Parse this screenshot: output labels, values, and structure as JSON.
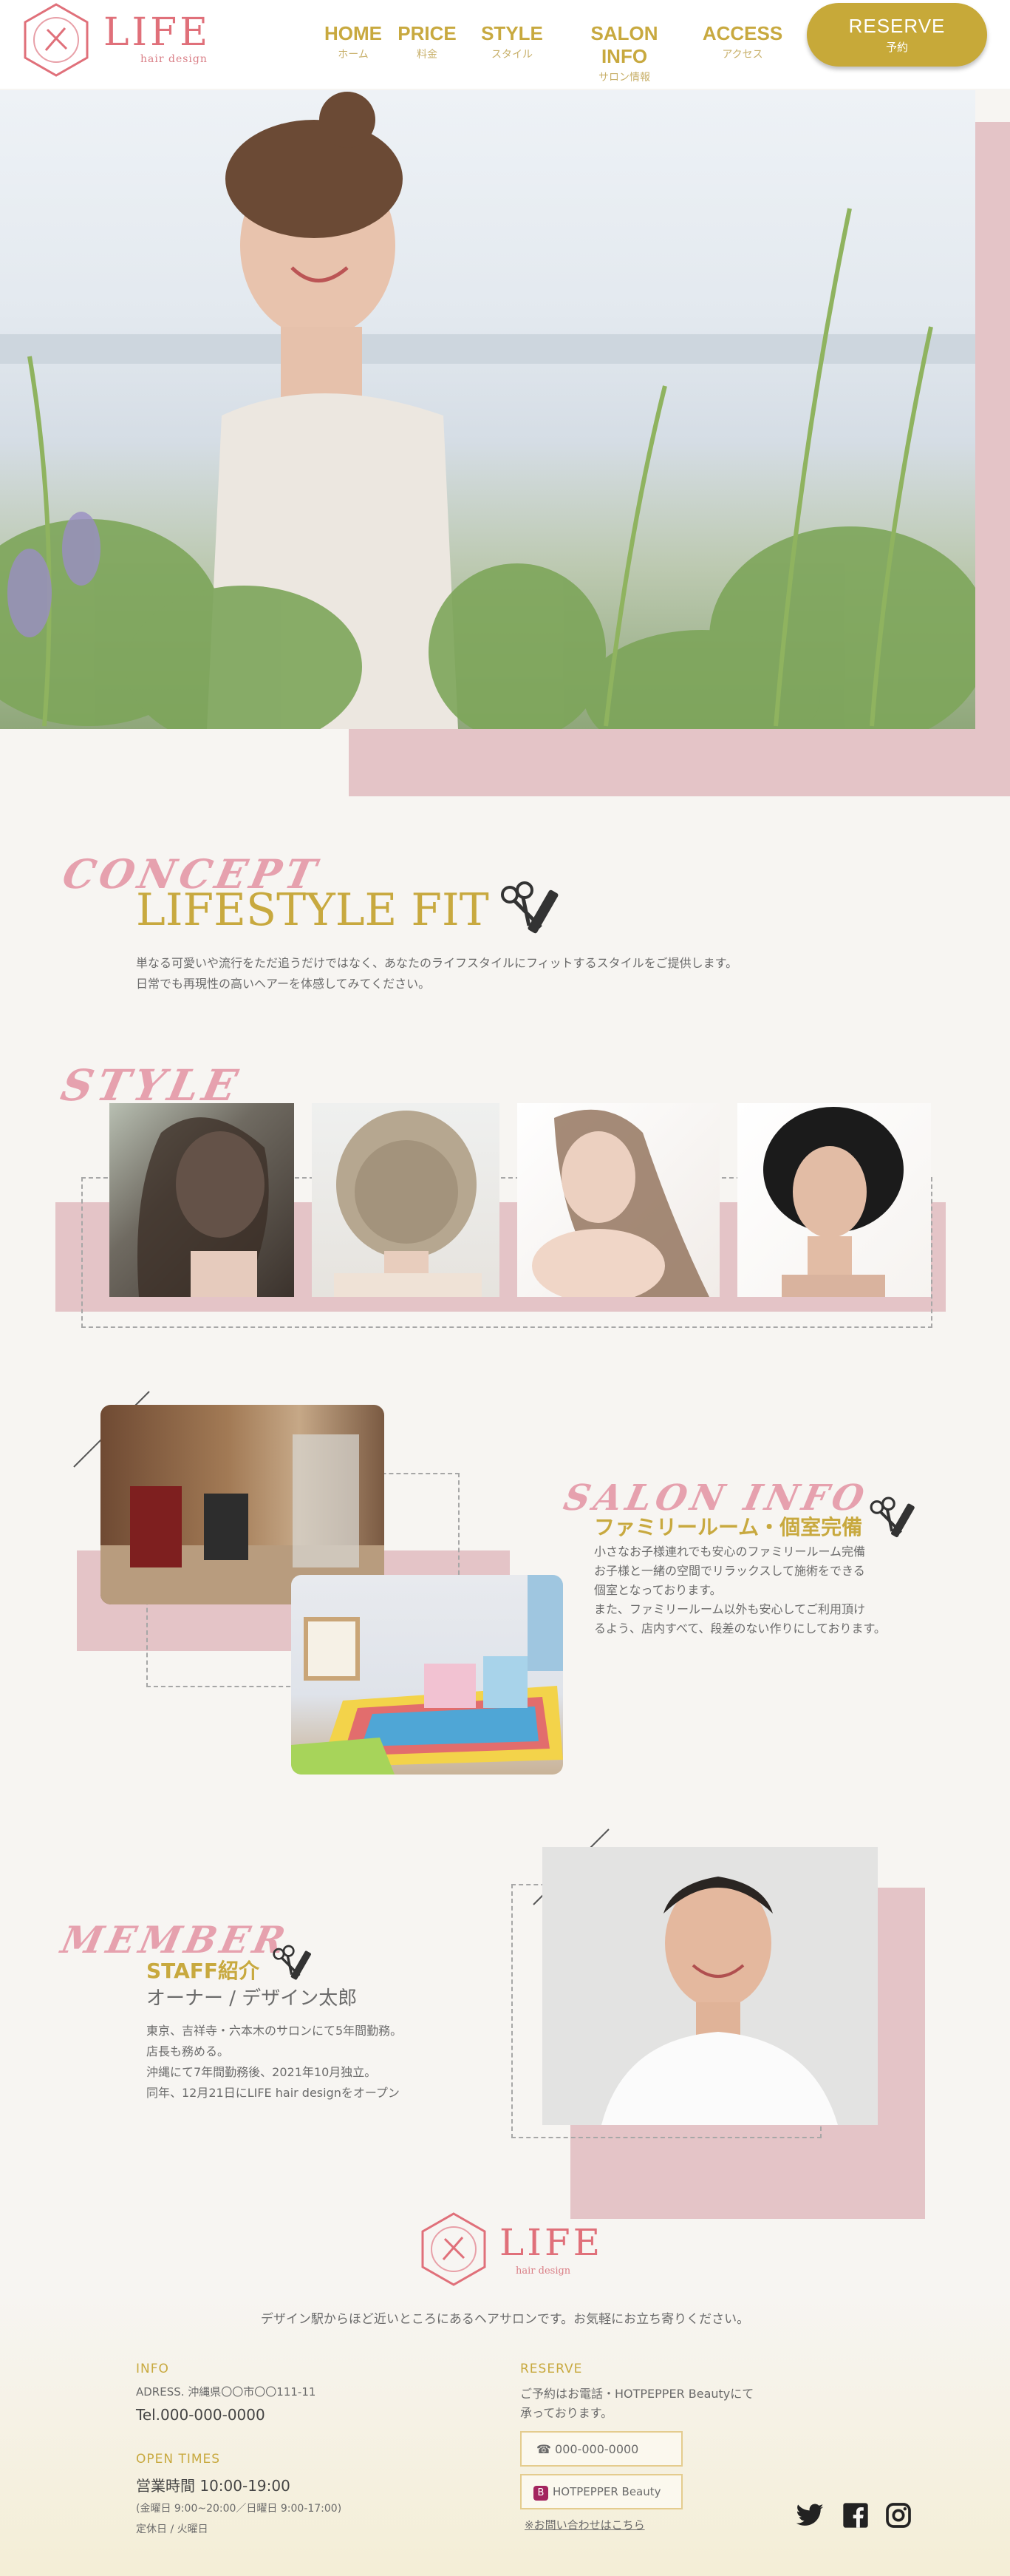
{
  "header": {
    "logo_text": "LIFE",
    "logo_sub": "hair design",
    "nav": [
      {
        "label": "HOME",
        "sub": "ホーム"
      },
      {
        "label": "PRICE",
        "sub": "料金"
      },
      {
        "label": "STYLE",
        "sub": "スタイル"
      },
      {
        "label": "SALON INFO",
        "sub": "サロン情報"
      },
      {
        "label": "ACCESS",
        "sub": "アクセス"
      }
    ],
    "reserve_label": "RESERVE",
    "reserve_sub": "予約"
  },
  "concept": {
    "script": "CONCEPT",
    "title": "LIFESTYLE FIT",
    "text_1": "単なる可愛いや流行をただ追うだけではなく、あなたのライフスタイルにフィットするスタイルをご提供します。",
    "text_2": "日常でも再現性の高いヘアーを体感してみてください。"
  },
  "style": {
    "script": "STYLE"
  },
  "salon": {
    "script": "SALON INFO",
    "title": "ファミリールーム・個室完備",
    "lines": [
      "小さなお子様連れでも安心のファミリールーム完備",
      "お子様と一緒の空間でリラックスして施術をできる",
      "個室となっております。",
      "また、ファミリールーム以外も安心してご利用頂け",
      "るよう、店内すべて、段差のない作りにしております。"
    ]
  },
  "member": {
    "script": "MEMBER",
    "title": "STAFF紹介",
    "name": "オーナー / デザイン太郎",
    "lines": [
      "東京、吉祥寺・六本木のサロンにて5年間勤務。",
      "店長も務める。",
      "沖縄にて7年間勤務後、2021年10月独立。",
      "同年、12月21日にLIFE hair designをオープン"
    ]
  },
  "footer": {
    "logo_text": "LIFE",
    "logo_sub": "hair design",
    "tagline": "デザイン駅からほど近いところにあるヘアサロンです。お気軽にお立ち寄りください。",
    "info_label": "INFO",
    "address": "ADRESS. 沖縄県〇〇市〇〇111-11",
    "tel": "Tel.000-000-0000",
    "open_label": "OPEN TIMES",
    "hours": "営業時間 10:00-19:00",
    "hours_note": "(金曜日 9:00~20:00／日曜日 9:00-17:00)",
    "holiday": "定休日 / 火曜日",
    "reserve_label": "RESERVE",
    "reserve_text_1": "ご予約はお電話・HOTPEPPER Beautyにて",
    "reserve_text_2": "承っております。",
    "phone_btn": "000-000-0000",
    "hotpepper_btn": "HOTPEPPER Beauty",
    "contact_link": "※お問い合わせはこちら"
  },
  "colors": {
    "gold": "#c8a93f",
    "pink": "#e4c4c7",
    "logo_pink": "#e0707a"
  },
  "icons": [
    "scissors-comb-icon",
    "phone-icon",
    "twitter-icon",
    "facebook-icon",
    "instagram-icon"
  ]
}
